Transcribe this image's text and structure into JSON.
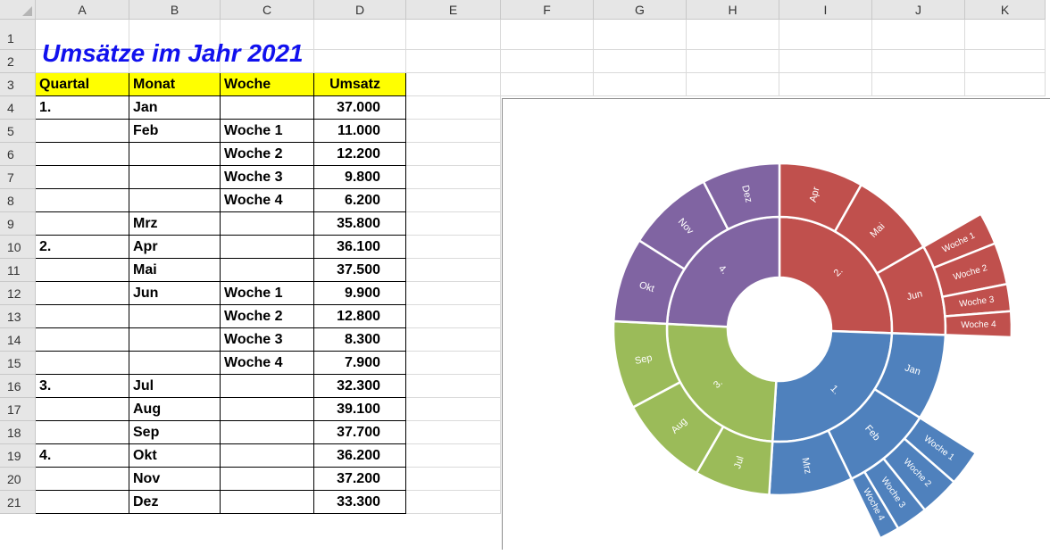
{
  "columns": [
    "A",
    "B",
    "C",
    "D",
    "E",
    "F",
    "G",
    "H",
    "I",
    "J",
    "K"
  ],
  "rows": [
    "1",
    "2",
    "3",
    "4",
    "5",
    "6",
    "7",
    "8",
    "9",
    "10",
    "11",
    "12",
    "13",
    "14",
    "15",
    "16",
    "17",
    "18",
    "19",
    "20",
    "21"
  ],
  "title": "Umsätze im Jahr 2021",
  "table": {
    "headers": [
      "Quartal",
      "Monat",
      "Woche",
      "Umsatz"
    ],
    "rows": [
      [
        "1.",
        "Jan",
        "",
        "37.000"
      ],
      [
        "",
        "Feb",
        "Woche 1",
        "11.000"
      ],
      [
        "",
        "",
        "Woche 2",
        "12.200"
      ],
      [
        "",
        "",
        "Woche 3",
        "9.800"
      ],
      [
        "",
        "",
        "Woche 4",
        "6.200"
      ],
      [
        "",
        "Mrz",
        "",
        "35.800"
      ],
      [
        "2.",
        "Apr",
        "",
        "36.100"
      ],
      [
        "",
        "Mai",
        "",
        "37.500"
      ],
      [
        "",
        "Jun",
        "Woche 1",
        "9.900"
      ],
      [
        "",
        "",
        "Woche 2",
        "12.800"
      ],
      [
        "",
        "",
        "Woche 3",
        "8.300"
      ],
      [
        "",
        "",
        "Woche 4",
        "7.900"
      ],
      [
        "3.",
        "Jul",
        "",
        "32.300"
      ],
      [
        "",
        "Aug",
        "",
        "39.100"
      ],
      [
        "",
        "Sep",
        "",
        "37.700"
      ],
      [
        "4.",
        "Okt",
        "",
        "36.200"
      ],
      [
        "",
        "Nov",
        "",
        "37.200"
      ],
      [
        "",
        "Dez",
        "",
        "33.300"
      ]
    ]
  },
  "colors": {
    "q1": "#4f81bd",
    "q2": "#c0504d",
    "q3": "#9bbb59",
    "q4": "#8064a2",
    "title": "#1111ee",
    "header_fill": "#ffff00"
  },
  "chart_data": {
    "type": "sunburst",
    "title": "",
    "data": [
      {
        "name": "1.",
        "color": "#4f81bd",
        "children": [
          {
            "name": "Jan",
            "value": 37000
          },
          {
            "name": "Feb",
            "children": [
              {
                "name": "Woche 1",
                "value": 11000
              },
              {
                "name": "Woche 2",
                "value": 12200
              },
              {
                "name": "Woche 3",
                "value": 9800
              },
              {
                "name": "Woche 4",
                "value": 6200
              }
            ]
          },
          {
            "name": "Mrz",
            "value": 35800
          }
        ]
      },
      {
        "name": "2.",
        "color": "#c0504d",
        "children": [
          {
            "name": "Apr",
            "value": 36100
          },
          {
            "name": "Mai",
            "value": 37500
          },
          {
            "name": "Jun",
            "children": [
              {
                "name": "Woche 1",
                "value": 9900
              },
              {
                "name": "Woche 2",
                "value": 12800
              },
              {
                "name": "Woche 3",
                "value": 8300
              },
              {
                "name": "Woche 4",
                "value": 7900
              }
            ]
          }
        ]
      },
      {
        "name": "3.",
        "color": "#9bbb59",
        "children": [
          {
            "name": "Jul",
            "value": 32300
          },
          {
            "name": "Aug",
            "value": 39100
          },
          {
            "name": "Sep",
            "value": 37700
          }
        ]
      },
      {
        "name": "4.",
        "color": "#8064a2",
        "children": [
          {
            "name": "Okt",
            "value": 36200
          },
          {
            "name": "Nov",
            "value": 37200
          },
          {
            "name": "Dez",
            "value": 33300
          }
        ]
      }
    ]
  }
}
